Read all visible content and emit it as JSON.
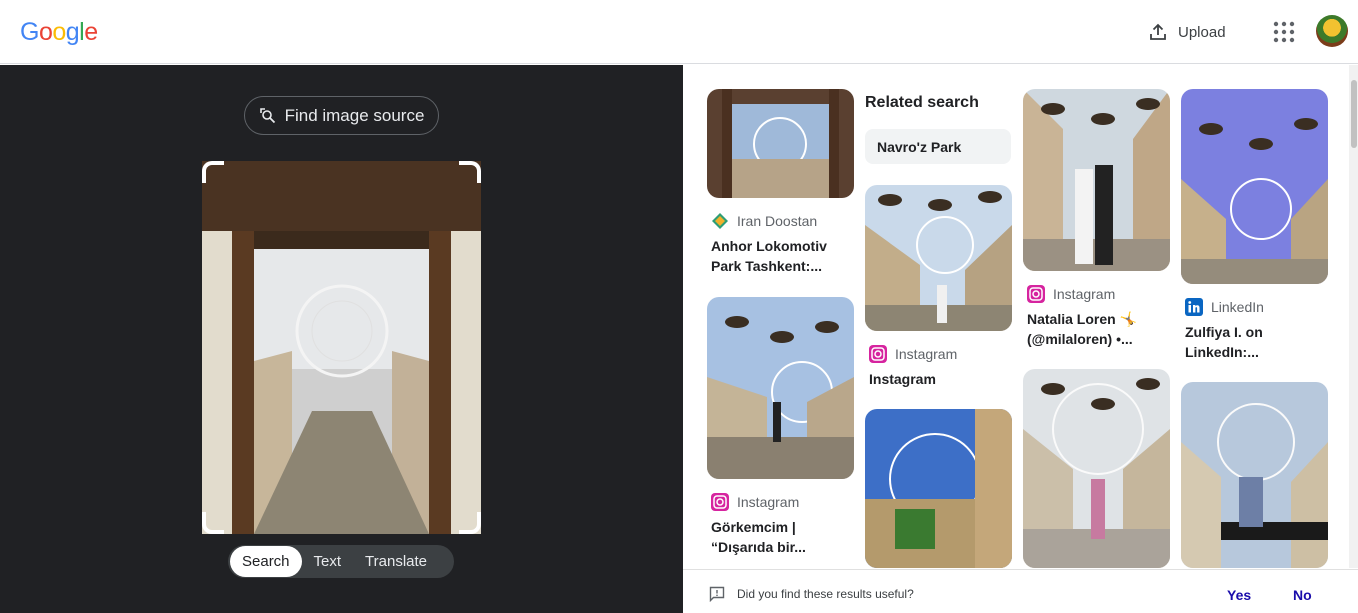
{
  "header": {
    "logo_letters": [
      "G",
      "o",
      "o",
      "g",
      "l",
      "e"
    ],
    "upload_label": "Upload",
    "apps_icon": "apps-grid-icon",
    "avatar_icon": "user-avatar"
  },
  "left": {
    "find_source_label": "Find image source",
    "modes": [
      "Search",
      "Text",
      "Translate"
    ],
    "active_mode": "Search"
  },
  "right": {
    "related": {
      "title": "Related search",
      "chip": "Navro'z Park"
    },
    "results": [
      {
        "source": "Iran Doostan",
        "caption_line1": "Anhor Lokomotiv",
        "caption_line2": "Park Tashkent:..."
      },
      {
        "source": "Instagram",
        "caption_line1": "Görkemcim |",
        "caption_line2": "“Dışarıda bir..."
      },
      {
        "source": "Instagram",
        "caption_line1": "Instagram",
        "caption_line2": ""
      },
      {
        "source": "Instagram",
        "caption_line1": "Natalia Loren 🤸",
        "caption_line2": "(@milaloren) •..."
      },
      {
        "source": "LinkedIn",
        "caption_line1": "Zulfiya I. on",
        "caption_line2": "LinkedIn:..."
      }
    ]
  },
  "feedback": {
    "question": "Did you find these results useful?",
    "yes": "Yes",
    "no": "No"
  },
  "colors": {
    "dark_bg": "#202124",
    "link": "#1a0dab",
    "google_blue": "#4285f4",
    "google_red": "#ea4335",
    "google_yellow": "#fbbc05",
    "google_green": "#34a853"
  }
}
